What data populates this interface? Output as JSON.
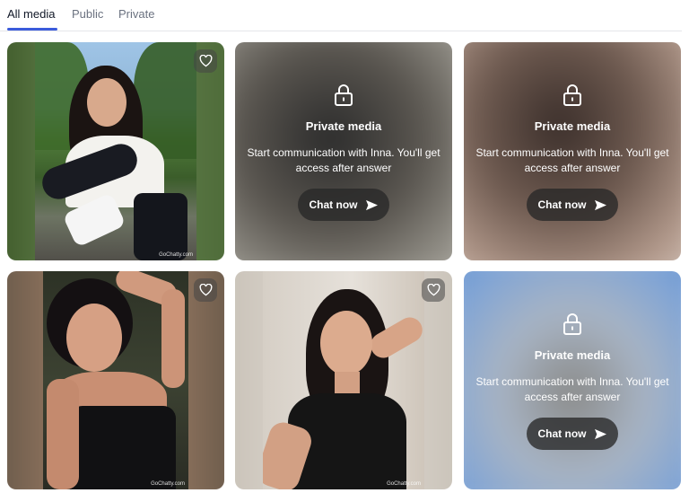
{
  "tabs": [
    {
      "label": "All media",
      "active": true
    },
    {
      "label": "Public",
      "active": false
    },
    {
      "label": "Private",
      "active": false
    }
  ],
  "media": [
    {
      "type": "photo",
      "watermark": "GoChatty.com",
      "icon": "heart-icon",
      "liked": false
    },
    {
      "type": "private",
      "title": "Private media",
      "description": "Start communication with Inna. You'll get access after answer",
      "button": "Chat now",
      "icon": "lock-icon"
    },
    {
      "type": "private",
      "title": "Private media",
      "description": "Start communication with Inna. You'll get access after answer",
      "button": "Chat now",
      "icon": "lock-icon"
    },
    {
      "type": "photo",
      "watermark": "GoChatty.com",
      "icon": "heart-icon",
      "liked": false
    },
    {
      "type": "photo",
      "watermark": "GoChatty.com",
      "icon": "heart-icon",
      "liked": false
    },
    {
      "type": "private",
      "title": "Private media",
      "description": "Start communication with Inna. You'll get access after answer",
      "button": "Chat now",
      "icon": "lock-icon"
    }
  ],
  "colors": {
    "accent": "#3b5bdb",
    "tab_inactive": "#6b7280",
    "button_bg": "#2e2e2e"
  }
}
